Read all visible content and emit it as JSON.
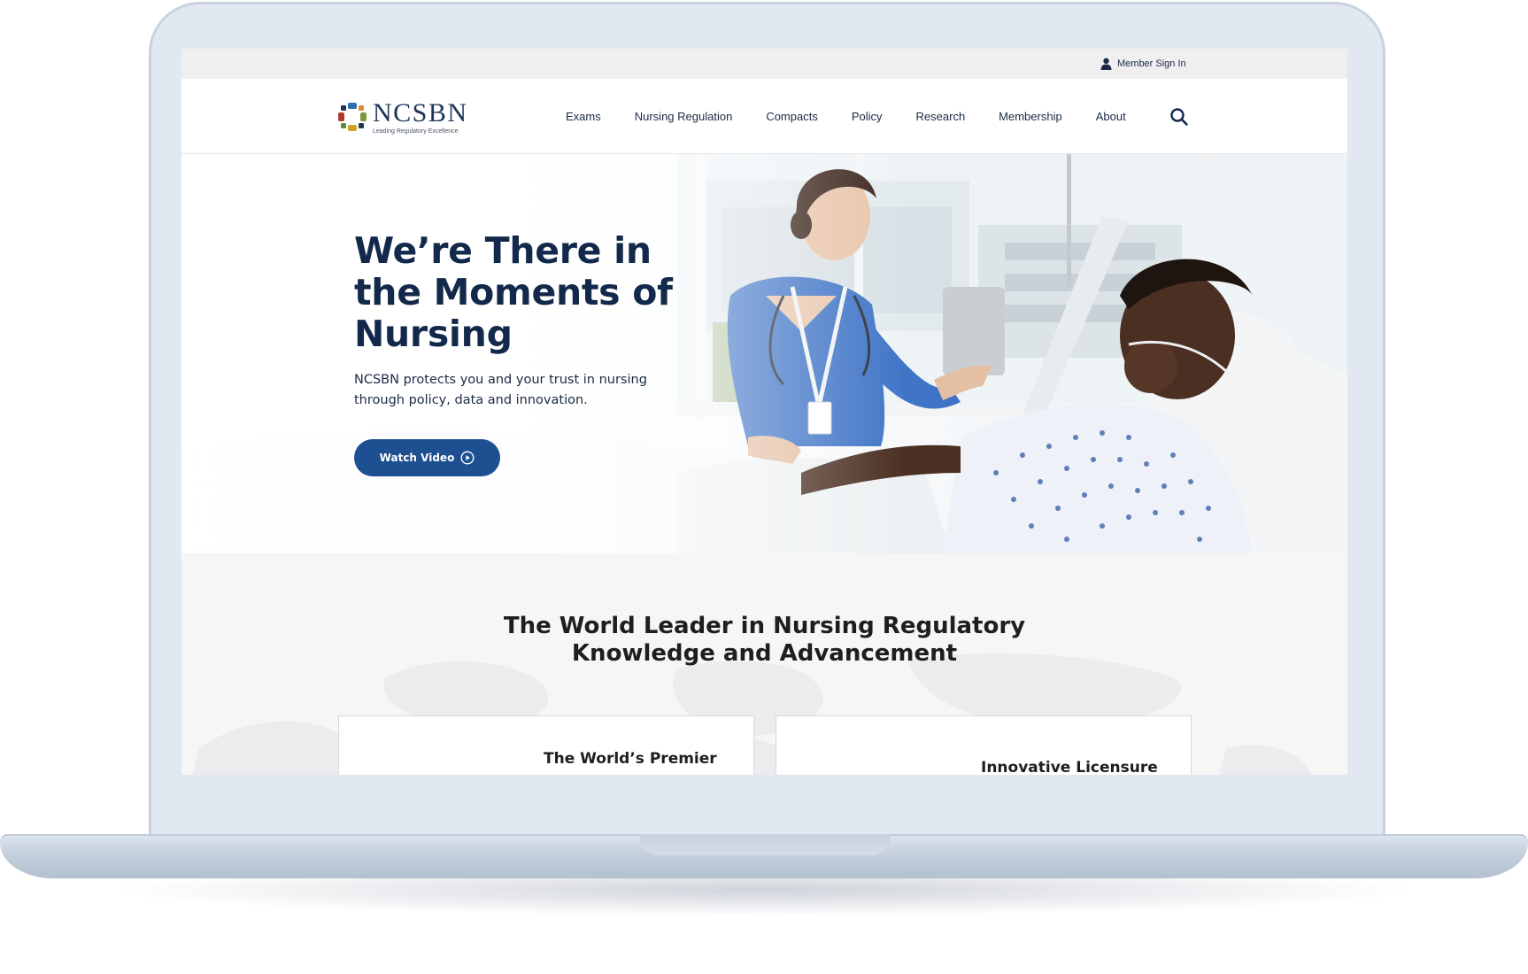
{
  "utility_bar": {
    "member_sign_in": "Member Sign In"
  },
  "header": {
    "logo_name": "NCSBN",
    "logo_tagline": "Leading Regulatory Excellence",
    "nav": [
      "Exams",
      "Nursing Regulation",
      "Compacts",
      "Policy",
      "Research",
      "Membership",
      "About"
    ]
  },
  "hero": {
    "title": "We’re There in the Moments of Nursing",
    "subtitle": "NCSBN protects you and your trust in nursing through policy, data and innovation.",
    "button_label": "Watch Video"
  },
  "section": {
    "title_line1": "The World Leader in Nursing Regulatory",
    "title_line2": "Knowledge and Advancement",
    "cards": [
      {
        "title": "The World’s Premier"
      },
      {
        "title": "Innovative Licensure"
      }
    ]
  },
  "colors": {
    "brand_navy": "#13294b",
    "button_blue": "#1d4f91",
    "laptop_frame": "#e1e8f1"
  },
  "icons": [
    "person-icon",
    "search-icon",
    "play-circle-icon",
    "ncsbn-logo-mark"
  ]
}
